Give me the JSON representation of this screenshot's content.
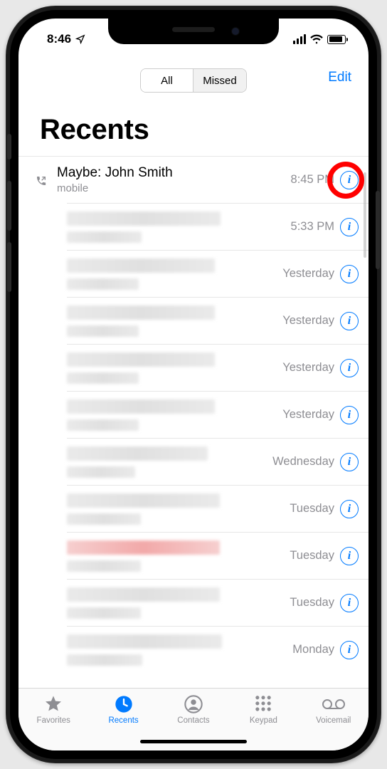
{
  "status": {
    "time": "8:46"
  },
  "header": {
    "segment_all": "All",
    "segment_missed": "Missed",
    "edit": "Edit",
    "title": "Recents"
  },
  "calls": [
    {
      "name": "Maybe: John Smith",
      "sub": "mobile",
      "time": "8:45 PM",
      "outgoing": true,
      "blurred": false,
      "highlight": true
    },
    {
      "name": "",
      "sub": "",
      "time": "5:33 PM",
      "outgoing": false,
      "blurred": true
    },
    {
      "name": "",
      "sub": "",
      "time": "Yesterday",
      "outgoing": false,
      "blurred": true
    },
    {
      "name": "",
      "sub": "",
      "time": "Yesterday",
      "outgoing": false,
      "blurred": true
    },
    {
      "name": "",
      "sub": "",
      "time": "Yesterday",
      "outgoing": false,
      "blurred": true
    },
    {
      "name": "",
      "sub": "",
      "time": "Yesterday",
      "outgoing": false,
      "blurred": true
    },
    {
      "name": "",
      "sub": "",
      "time": "Wednesday",
      "outgoing": false,
      "blurred": true
    },
    {
      "name": "",
      "sub": "",
      "time": "Tuesday",
      "outgoing": false,
      "blurred": true
    },
    {
      "name": "",
      "sub": "",
      "time": "Tuesday",
      "outgoing": false,
      "blurred": true,
      "red": true
    },
    {
      "name": "",
      "sub": "",
      "time": "Tuesday",
      "outgoing": false,
      "blurred": true
    },
    {
      "name": "",
      "sub": "",
      "time": "Monday",
      "outgoing": false,
      "blurred": true
    }
  ],
  "tabs": {
    "favorites": "Favorites",
    "recents": "Recents",
    "contacts": "Contacts",
    "keypad": "Keypad",
    "voicemail": "Voicemail"
  }
}
